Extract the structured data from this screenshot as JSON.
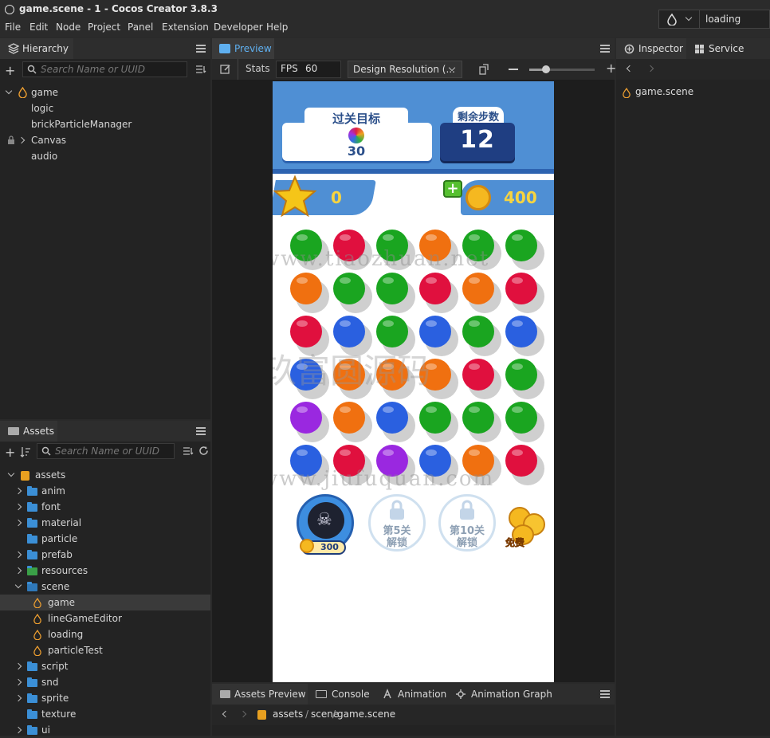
{
  "window": {
    "title": "game.scene - 1 - Cocos Creator 3.8.3"
  },
  "menu": [
    "File",
    "Edit",
    "Node",
    "Project",
    "Panel",
    "Extension",
    "Developer",
    "Help"
  ],
  "scene_select": {
    "value": "loading"
  },
  "hierarchy": {
    "tab": "Hierarchy",
    "search_placeholder": "Search Name or UUID",
    "nodes": [
      {
        "label": "game"
      },
      {
        "label": "logic"
      },
      {
        "label": "brickParticleManager"
      },
      {
        "label": "Canvas"
      },
      {
        "label": "audio"
      }
    ]
  },
  "assets": {
    "tab": "Assets",
    "search_placeholder": "Search Name or UUID",
    "items": [
      {
        "label": "assets",
        "type": "db"
      },
      {
        "label": "anim",
        "type": "folder"
      },
      {
        "label": "font",
        "type": "folder"
      },
      {
        "label": "material",
        "type": "folder"
      },
      {
        "label": "particle",
        "type": "folder"
      },
      {
        "label": "prefab",
        "type": "folder"
      },
      {
        "label": "resources",
        "type": "folder"
      },
      {
        "label": "scene",
        "type": "folder"
      },
      {
        "label": "game",
        "type": "scene"
      },
      {
        "label": "lineGameEditor",
        "type": "scene"
      },
      {
        "label": "loading",
        "type": "scene"
      },
      {
        "label": "particleTest",
        "type": "scene"
      },
      {
        "label": "script",
        "type": "folder"
      },
      {
        "label": "snd",
        "type": "folder"
      },
      {
        "label": "sprite",
        "type": "folder"
      },
      {
        "label": "texture",
        "type": "folder"
      },
      {
        "label": "ui",
        "type": "folder"
      }
    ]
  },
  "preview": {
    "tab": "Preview",
    "stats_label": "Stats",
    "fps_label": "FPS",
    "fps_value": "60",
    "resolution": "Design Resolution (...",
    "zoom_level": 0.25
  },
  "game": {
    "goal_title": "过关目标",
    "goal_count": "30",
    "steps_title": "剩余步数",
    "steps_value": "12",
    "stars": "0",
    "coins": "400",
    "ball_colors": {
      "G": "#1aa520",
      "R": "#e0103e",
      "O": "#f07010",
      "B": "#2a60e0",
      "P": "#9a28e0"
    },
    "grid": [
      [
        "G",
        "R",
        "G",
        "O",
        "G",
        "G"
      ],
      [
        "O",
        "G",
        "G",
        "R",
        "O",
        "R"
      ],
      [
        "R",
        "B",
        "G",
        "B",
        "G",
        "B"
      ],
      [
        "B",
        "O",
        "O",
        "O",
        "R",
        "G"
      ],
      [
        "P",
        "O",
        "B",
        "G",
        "G",
        "G"
      ],
      [
        "B",
        "R",
        "P",
        "B",
        "O",
        "R"
      ]
    ],
    "bomb_price": "300",
    "lock1": [
      "第5关",
      "解锁"
    ],
    "lock2": [
      "第10关",
      "解锁"
    ],
    "free_label": "免费"
  },
  "watermarks": [
    "www.tiaozhuan.net",
    "玖富圆源码",
    "www.jiufuquan.com"
  ],
  "inspector": {
    "tabs": [
      "Inspector",
      "Service"
    ],
    "item": "game.scene"
  },
  "bottom": {
    "tabs": [
      "Assets Preview",
      "Console",
      "Animation",
      "Animation Graph"
    ],
    "path": [
      "assets",
      "scene",
      "game.scene"
    ]
  }
}
